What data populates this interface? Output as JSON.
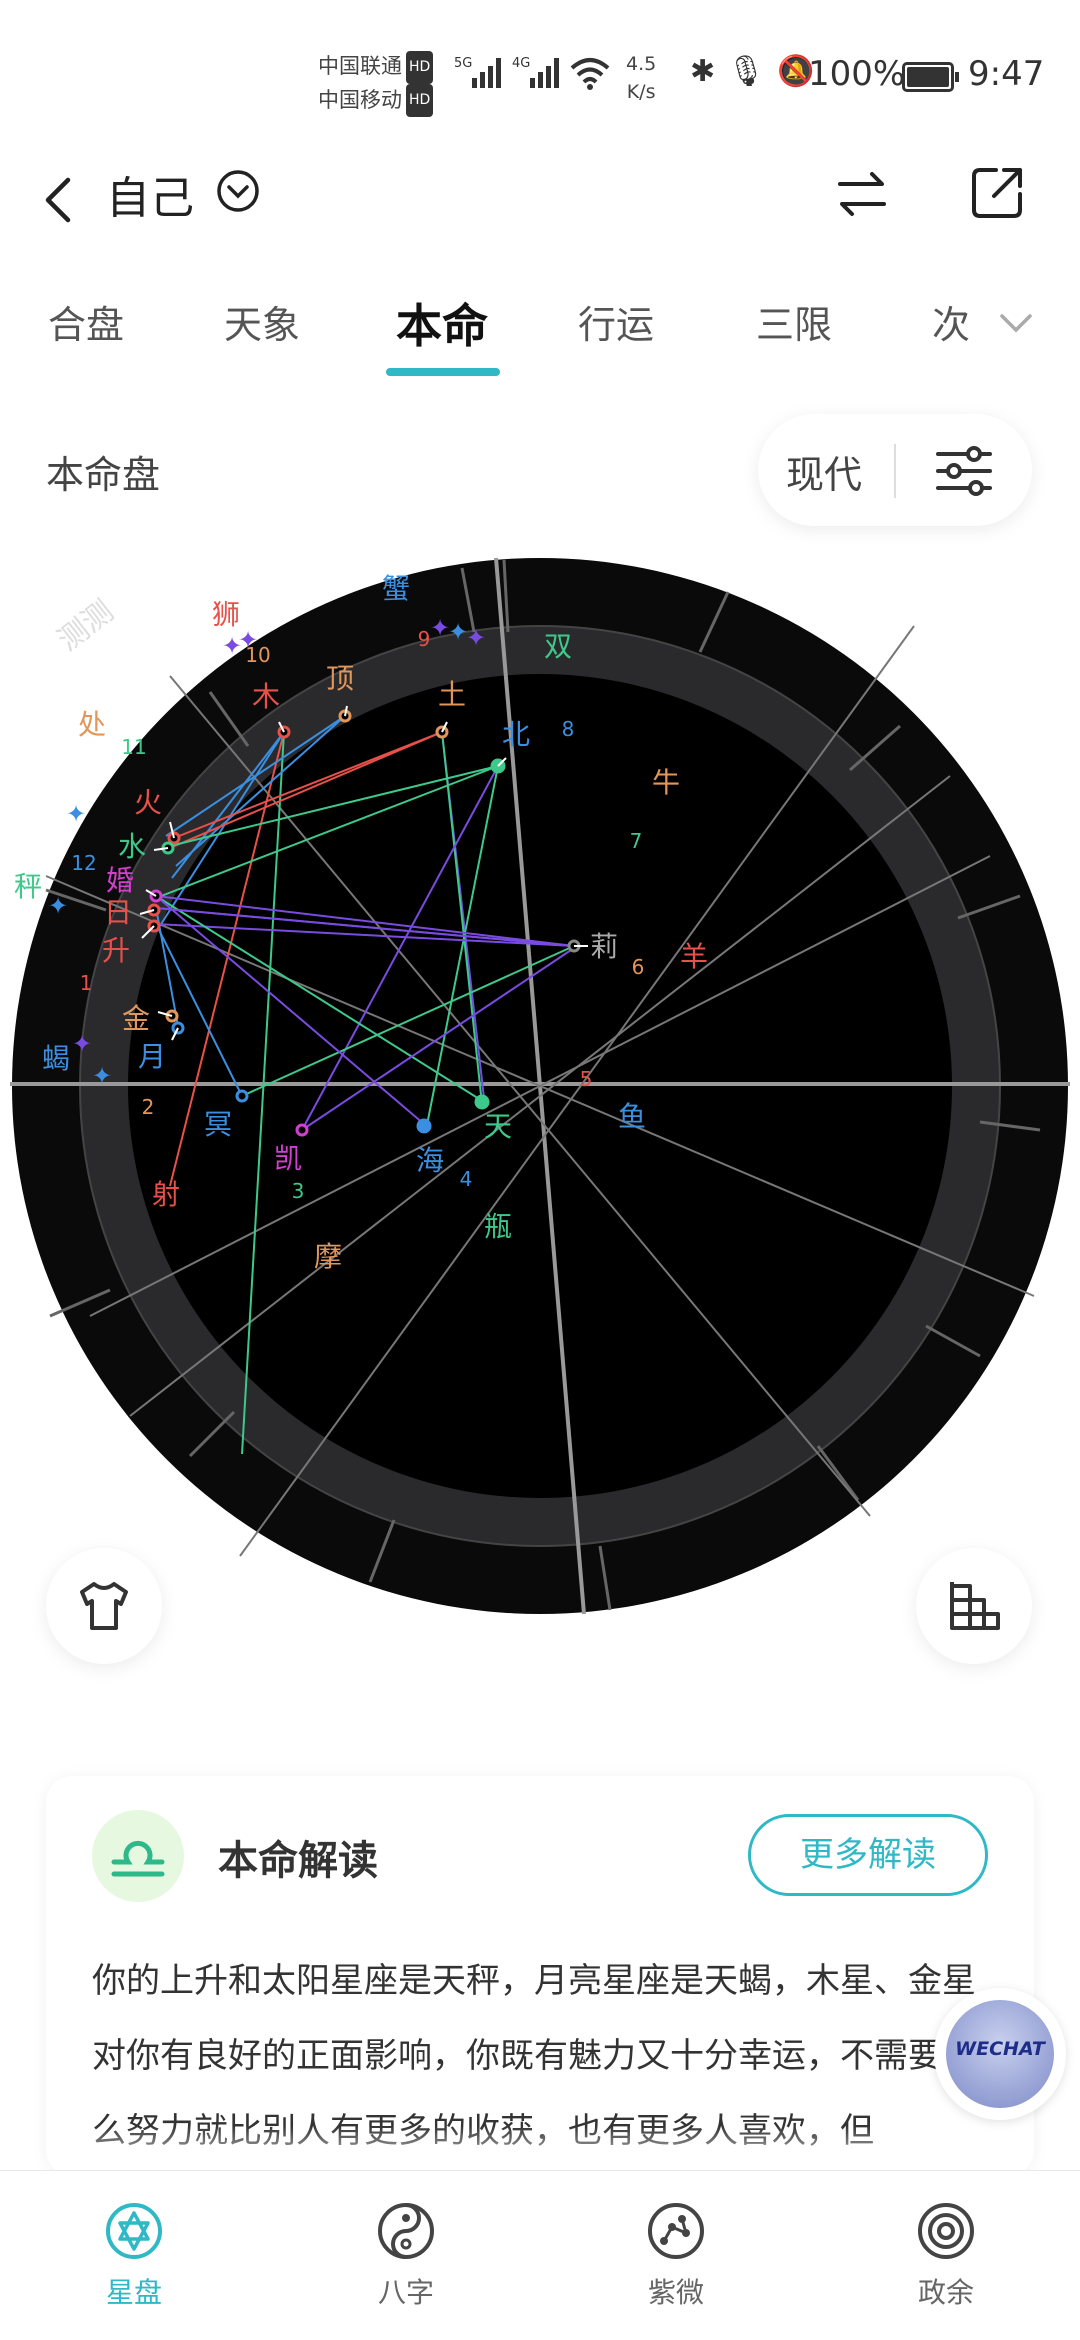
{
  "status": {
    "carrier1": "中国联通",
    "carrier2": "中国移动",
    "hd": "HD",
    "net1": "5G",
    "net2": "4G",
    "speed_value": "4.5",
    "speed_unit": "K/s",
    "battery": "100%",
    "time": "9:47"
  },
  "header": {
    "title": "自己",
    "icons": [
      "back-icon",
      "chevron-down-icon",
      "swap-icon",
      "share-icon"
    ]
  },
  "tabs": [
    {
      "label": "合盘",
      "active": false
    },
    {
      "label": "天象",
      "active": false
    },
    {
      "label": "本命",
      "active": true
    },
    {
      "label": "行运",
      "active": false
    },
    {
      "label": "三限",
      "active": false
    },
    {
      "label": "次",
      "active": false
    }
  ],
  "chart": {
    "label": "本命盘",
    "mode": "现代",
    "watermark": "测测",
    "signs": [
      "蟹",
      "双",
      "牛",
      "羊",
      "鱼",
      "瓶",
      "摩",
      "射",
      "蝎",
      "秤",
      "处",
      "狮"
    ],
    "houses": [
      "1",
      "2",
      "3",
      "4",
      "5",
      "6",
      "7",
      "8",
      "9",
      "10",
      "11",
      "12"
    ],
    "planets": [
      "顶",
      "土",
      "北",
      "木",
      "火",
      "水",
      "婚",
      "日",
      "升",
      "金",
      "月",
      "冥",
      "凯",
      "海",
      "天",
      "莉"
    ],
    "colors": {
      "fire": "#e8504a",
      "earth": "#e3965a",
      "air": "#3ec98b",
      "water": "#3b8fe0",
      "purple": "#7a4be0",
      "magenta": "#d33fd0"
    }
  },
  "reading": {
    "title": "本命解读",
    "more": "更多解读",
    "text": "你的上升和太阳星座是天秤，月亮星座是天蝎，木星、金星对你有良好的正面影响，你既有魅力又十分幸运，不需要怎么努力就比别人有更多的收获，也有更多人喜欢，但"
  },
  "wechat": "WECHAT",
  "nav": [
    {
      "label": "星盘",
      "icon": "star-chart-icon",
      "active": true
    },
    {
      "label": "八字",
      "icon": "yin-yang-icon",
      "active": false
    },
    {
      "label": "紫微",
      "icon": "constellation-icon",
      "active": false
    },
    {
      "label": "政余",
      "icon": "target-icon",
      "active": false
    }
  ]
}
